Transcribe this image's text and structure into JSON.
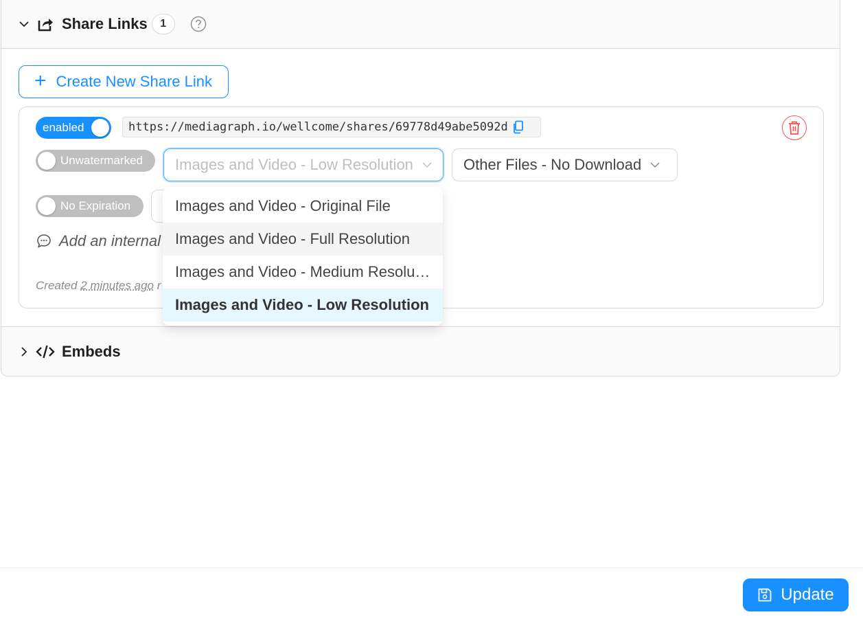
{
  "share_links": {
    "title": "Share Links",
    "count": "1",
    "create_button_label": "Create New Share Link",
    "link": {
      "enabled_label": "enabled",
      "url": "https://mediagraph.io/wellcome/shares/69778d49abe5092d",
      "watermark_label": "Unwatermarked",
      "expiration_label": "No Expiration",
      "images_select_value": "Images and Video - Low Resolution",
      "other_files_select_value": "Other Files - No Download",
      "note_placeholder": "Add an internal",
      "created_prefix": "Created",
      "created_ago": "2 minutes ago",
      "created_suffix": "r"
    },
    "dropdown_options": [
      "Images and Video - Original File",
      "Images and Video - Full Resolution",
      "Images and Video - Medium Resolution",
      "Images and Video - Low Resolution"
    ]
  },
  "embeds": {
    "title": "Embeds"
  },
  "footer": {
    "update_label": "Update"
  },
  "colors": {
    "accent": "#1890ff",
    "danger": "#ff4d4f",
    "toggle_off": "#bfbfbf"
  },
  "icons": [
    "chevron-down-icon",
    "share-icon",
    "help-icon",
    "plus-icon",
    "copy-icon",
    "trash-icon",
    "caret-down-icon",
    "comment-icon",
    "chevron-right-icon",
    "code-icon",
    "save-icon"
  ]
}
